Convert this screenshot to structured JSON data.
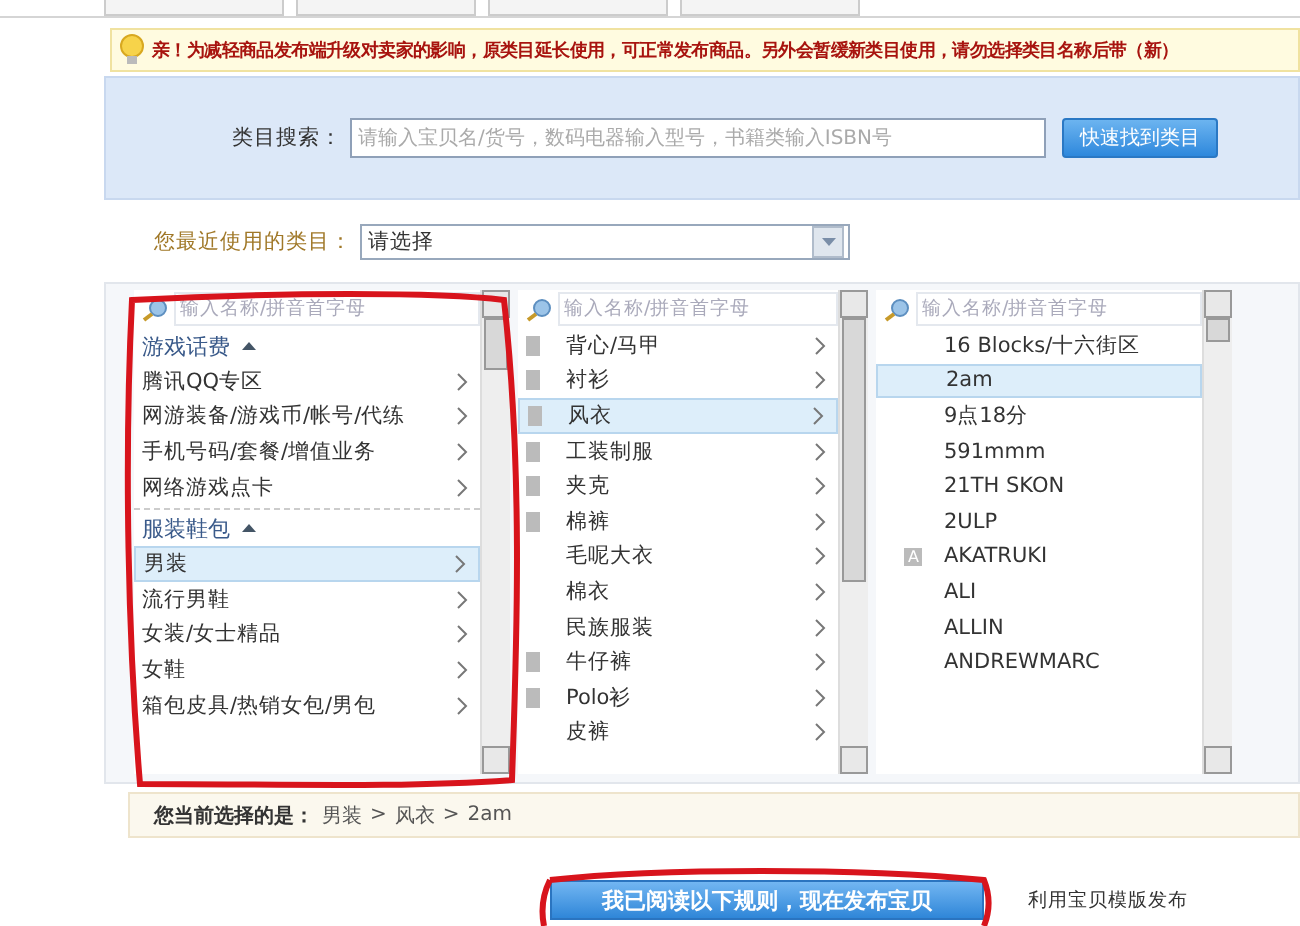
{
  "notice": {
    "text": "亲！为减轻商品发布端升级对卖家的影响，原类目延长使用，可正常发布商品。另外会暂缓新类目使用，请勿选择类目名称后带（新）"
  },
  "category_search": {
    "label": "类目搜索：",
    "placeholder": "请输入宝贝名/货号，数码电器输入型号，书籍类输入ISBN号",
    "button": "快速找到类目"
  },
  "recent": {
    "label": "您最近使用的类目：",
    "value": "请选择"
  },
  "columns": [
    {
      "search_placeholder": "输入名称/拼音首字母",
      "items": [
        {
          "kind": "group",
          "label": "游戏话费",
          "expanded": true
        },
        {
          "kind": "item",
          "label": "腾讯QQ专区",
          "selected": false
        },
        {
          "kind": "item",
          "label": "网游装备/游戏币/帐号/代练",
          "selected": false
        },
        {
          "kind": "item",
          "label": "手机号码/套餐/增值业务",
          "selected": false
        },
        {
          "kind": "item",
          "label": "网络游戏点卡",
          "selected": false
        },
        {
          "kind": "group",
          "label": "服装鞋包",
          "expanded": true
        },
        {
          "kind": "item",
          "label": "男装",
          "selected": true
        },
        {
          "kind": "item",
          "label": "流行男鞋",
          "selected": false
        },
        {
          "kind": "item",
          "label": "女装/女士精品",
          "selected": false
        },
        {
          "kind": "item",
          "label": "女鞋",
          "selected": false
        },
        {
          "kind": "item",
          "label": "箱包皮具/热销女包/男包",
          "selected": false
        }
      ]
    },
    {
      "search_placeholder": "输入名称/拼音首字母",
      "items": [
        {
          "kind": "item",
          "label": "背心/马甲",
          "selected": false,
          "marker": true
        },
        {
          "kind": "item",
          "label": "衬衫",
          "selected": false,
          "marker": true
        },
        {
          "kind": "item",
          "label": "风衣",
          "selected": true,
          "marker": true
        },
        {
          "kind": "item",
          "label": "工装制服",
          "selected": false,
          "marker": true
        },
        {
          "kind": "item",
          "label": "夹克",
          "selected": false,
          "marker": true
        },
        {
          "kind": "item",
          "label": "棉裤",
          "selected": false,
          "marker": true
        },
        {
          "kind": "item",
          "label": "毛呢大衣",
          "selected": false,
          "marker": false
        },
        {
          "kind": "item",
          "label": "棉衣",
          "selected": false,
          "marker": false
        },
        {
          "kind": "item",
          "label": "民族服装",
          "selected": false,
          "marker": false
        },
        {
          "kind": "item",
          "label": "牛仔裤",
          "selected": false,
          "marker": true
        },
        {
          "kind": "item",
          "label": "Polo衫",
          "selected": false,
          "marker": true
        },
        {
          "kind": "item",
          "label": "皮裤",
          "selected": false,
          "marker": false
        }
      ]
    },
    {
      "search_placeholder": "输入名称/拼音首字母",
      "items": [
        {
          "kind": "leaf",
          "label": "16 Blocks/十六街区",
          "selected": false
        },
        {
          "kind": "leaf",
          "label": "2am",
          "selected": true
        },
        {
          "kind": "leaf",
          "label": "9点18分",
          "selected": false
        },
        {
          "kind": "leaf",
          "label": "591mmm",
          "selected": false
        },
        {
          "kind": "leaf",
          "label": "21TH SKON",
          "selected": false
        },
        {
          "kind": "leaf",
          "label": "2ULP",
          "selected": false
        },
        {
          "kind": "leaf",
          "label": "AKATRUKI",
          "selected": false,
          "index": "A"
        },
        {
          "kind": "leaf",
          "label": "ALI",
          "selected": false
        },
        {
          "kind": "leaf",
          "label": "ALLIN",
          "selected": false
        },
        {
          "kind": "leaf",
          "label": "ANDREWMARC",
          "selected": false
        }
      ]
    }
  ],
  "current": {
    "label": "您当前选择的是：",
    "path": [
      "男装",
      "风衣",
      "2am"
    ],
    "separator": ">"
  },
  "actions": {
    "publish_button": "我已阅读以下规则，现在发布宝贝",
    "template_link": "利用宝贝模版发布"
  }
}
